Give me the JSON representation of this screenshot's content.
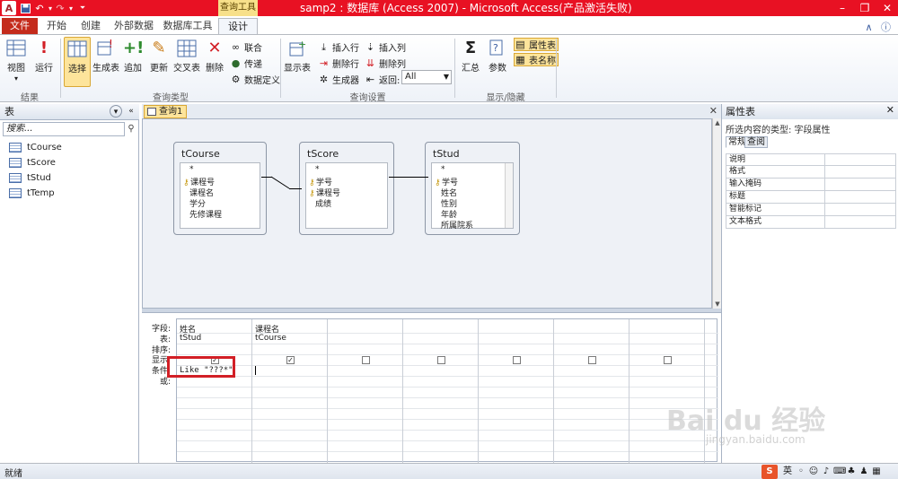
{
  "titlebar": {
    "context_tab_title": "查询工具",
    "window_title": "samp2 : 数据库 (Access 2007) - Microsoft Access(产品激活失败)"
  },
  "tabs": [
    "文件",
    "开始",
    "创建",
    "外部数据",
    "数据库工具",
    "设计"
  ],
  "ribbon": {
    "results": {
      "view": "视图",
      "run": "运行",
      "label": "结果"
    },
    "query_type": {
      "select": "选择",
      "make_table": "生成表",
      "append": "追加",
      "update": "更新",
      "crosstab": "交叉表",
      "delete": "删除",
      "union": "联合",
      "pass_through": "传递",
      "data_definition": "数据定义",
      "label": "查询类型"
    },
    "query_setup": {
      "show_table": "显示表",
      "insert_rows": "插入行",
      "delete_rows": "删除行",
      "builder": "生成器",
      "insert_columns": "插入列",
      "delete_columns": "删除列",
      "return_label": "返回:",
      "return_value": "All",
      "label": "查询设置"
    },
    "show_hide": {
      "totals": "汇总",
      "parameters": "参数",
      "property_sheet": "属性表",
      "table_names": "表名称",
      "label": "显示/隐藏"
    }
  },
  "nav": {
    "header": "表",
    "search_placeholder": "搜索...",
    "items": [
      "tCourse",
      "tScore",
      "tStud",
      "tTemp"
    ]
  },
  "document": {
    "tab": "查询1",
    "tables": [
      {
        "name": "tCourse",
        "fields": [
          "*",
          "课程号",
          "课程名",
          "学分",
          "先修课程"
        ],
        "keys": [
          1
        ]
      },
      {
        "name": "tScore",
        "fields": [
          "*",
          "学号",
          "课程号",
          "成绩"
        ],
        "keys": [
          1,
          2
        ]
      },
      {
        "name": "tStud",
        "fields": [
          "*",
          "学号",
          "姓名",
          "性别",
          "年龄",
          "所属院系"
        ],
        "keys": [
          1
        ]
      }
    ],
    "row_labels": [
      "字段:",
      "表:",
      "排序:",
      "显示:",
      "条件:",
      "或:"
    ],
    "columns": [
      {
        "field": "姓名",
        "table": "tStud",
        "show": true,
        "criteria": "Like \"???*\""
      },
      {
        "field": "课程名",
        "table": "tCourse",
        "show": true,
        "criteria": ""
      },
      {
        "field": "",
        "table": "",
        "show": false,
        "criteria": ""
      },
      {
        "field": "",
        "table": "",
        "show": false,
        "criteria": ""
      },
      {
        "field": "",
        "table": "",
        "show": false,
        "criteria": ""
      },
      {
        "field": "",
        "table": "",
        "show": false,
        "criteria": ""
      },
      {
        "field": "",
        "table": "",
        "show": false,
        "criteria": ""
      }
    ]
  },
  "props": {
    "title": "属性表",
    "selection_type": "所选内容的类型: 字段属性",
    "tabs": [
      "常规",
      "查阅"
    ],
    "rows": [
      "说明",
      "格式",
      "输入掩码",
      "标题",
      "智能标记",
      "文本格式"
    ]
  },
  "watermark": {
    "text": "Bai du 经验",
    "url": "jingyan.baidu.com"
  },
  "status": {
    "text": "就绪",
    "ime": "英"
  },
  "colors": {
    "title_bar": "#e81123",
    "file_tab": "#c42b1c",
    "context_tab": "#f7e08a",
    "highlight": "#fde49b",
    "annotation": "#d21f26"
  }
}
